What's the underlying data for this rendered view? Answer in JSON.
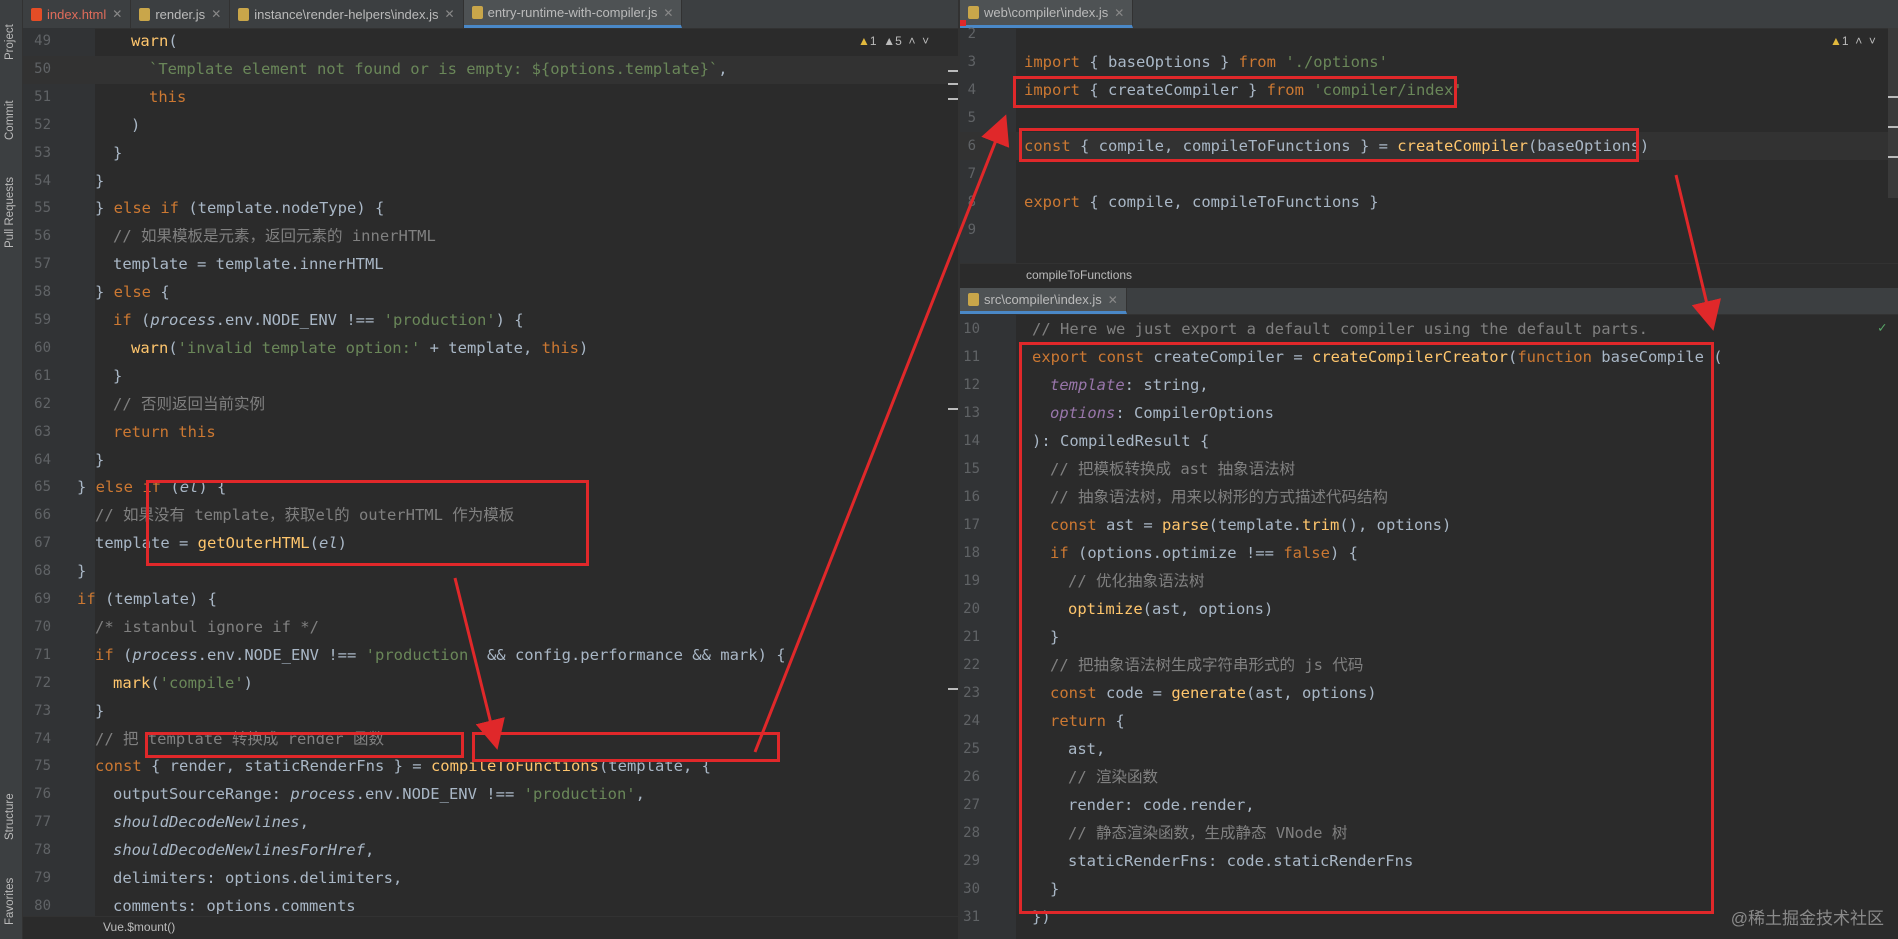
{
  "toolstrip": [
    "Project",
    "Commit",
    "Pull Requests",
    "Structure",
    "Favorites"
  ],
  "left": {
    "tabs": [
      "index.html",
      "render.js",
      "instance\\render-helpers\\index.js",
      "entry-runtime-with-compiler.js"
    ],
    "warnings": {
      "w": "1",
      "w2": "5"
    },
    "breadcrumb": "Vue.$mount()",
    "lines": [
      {
        "n": "49",
        "html": "warn("
      },
      {
        "n": "50",
        "html": "`Template element not found or is empty: ${options.template}`,"
      },
      {
        "n": "51",
        "html": "this"
      },
      {
        "n": "52",
        "html": ")"
      },
      {
        "n": "53",
        "html": "}"
      },
      {
        "n": "54",
        "html": "}"
      },
      {
        "n": "55",
        "html": "} else if (template.nodeType) {"
      },
      {
        "n": "56",
        "html": "// 如果模板是元素，返回元素的 innerHTML"
      },
      {
        "n": "57",
        "html": "template = template.innerHTML"
      },
      {
        "n": "58",
        "html": "} else {"
      },
      {
        "n": "59",
        "html": "if (process.env.NODE_ENV !== 'production') {"
      },
      {
        "n": "60",
        "html": "warn('invalid template option:' + template, this)"
      },
      {
        "n": "61",
        "html": "}"
      },
      {
        "n": "62",
        "html": "// 否则返回当前实例"
      },
      {
        "n": "63",
        "html": "return this"
      },
      {
        "n": "64",
        "html": "}"
      },
      {
        "n": "65",
        "html": "} else if (el) {"
      },
      {
        "n": "66",
        "html": "// 如果没有 template，获取el的 outerHTML 作为模板"
      },
      {
        "n": "67",
        "html": "template = getOuterHTML(el)"
      },
      {
        "n": "68",
        "html": "}"
      },
      {
        "n": "69",
        "html": "if (template) {"
      },
      {
        "n": "70",
        "html": "/* istanbul ignore if */"
      },
      {
        "n": "71",
        "html": "if (process.env.NODE_ENV !== 'production' && config.performance && mark) {"
      },
      {
        "n": "72",
        "html": "mark('compile')"
      },
      {
        "n": "73",
        "html": "}"
      },
      {
        "n": "74",
        "html": "// 把 template 转换成 render 函数"
      },
      {
        "n": "75",
        "html": "const { render, staticRenderFns } = compileToFunctions(template, {"
      },
      {
        "n": "76",
        "html": "outputSourceRange: process.env.NODE_ENV !== 'production',"
      },
      {
        "n": "77",
        "html": "shouldDecodeNewlines,"
      },
      {
        "n": "78",
        "html": "shouldDecodeNewlinesForHref,"
      },
      {
        "n": "79",
        "html": "delimiters: options.delimiters,"
      },
      {
        "n": "80",
        "html": "comments: options.comments"
      }
    ]
  },
  "rightTop": {
    "tab": "web\\compiler\\index.js",
    "warnings": "1",
    "breadcrumb": "compileToFunctions",
    "lines": [
      {
        "n": "2",
        "t": ""
      },
      {
        "n": "3",
        "t": "import { baseOptions } from './options'"
      },
      {
        "n": "4",
        "t": "import { createCompiler } from 'compiler/index'"
      },
      {
        "n": "5",
        "t": ""
      },
      {
        "n": "6",
        "t": "const { compile, compileToFunctions } = createCompiler(baseOptions)"
      },
      {
        "n": "7",
        "t": ""
      },
      {
        "n": "8",
        "t": "export { compile, compileToFunctions }"
      },
      {
        "n": "9",
        "t": ""
      }
    ]
  },
  "rightBottom": {
    "tab": "src\\compiler\\index.js",
    "lines": [
      {
        "n": "10",
        "t": "// Here we just export a default compiler using the default parts."
      },
      {
        "n": "11",
        "t": "export const createCompiler = createCompilerCreator(function baseCompile ("
      },
      {
        "n": "12",
        "t": "template: string,"
      },
      {
        "n": "13",
        "t": "options: CompilerOptions"
      },
      {
        "n": "14",
        "t": "): CompiledResult {"
      },
      {
        "n": "15",
        "t": "// 把模板转换成 ast 抽象语法树"
      },
      {
        "n": "16",
        "t": "// 抽象语法树，用来以树形的方式描述代码结构"
      },
      {
        "n": "17",
        "t": "const ast = parse(template.trim(), options)"
      },
      {
        "n": "18",
        "t": "if (options.optimize !== false) {"
      },
      {
        "n": "19",
        "t": "// 优化抽象语法树"
      },
      {
        "n": "20",
        "t": "optimize(ast, options)"
      },
      {
        "n": "21",
        "t": "}"
      },
      {
        "n": "22",
        "t": "// 把抽象语法树生成字符串形式的 js 代码"
      },
      {
        "n": "23",
        "t": "const code = generate(ast, options)"
      },
      {
        "n": "24",
        "t": "return {"
      },
      {
        "n": "25",
        "t": "ast,"
      },
      {
        "n": "26",
        "t": "// 渲染函数"
      },
      {
        "n": "27",
        "t": "render: code.render,"
      },
      {
        "n": "28",
        "t": "// 静态渲染函数，生成静态 VNode 树"
      },
      {
        "n": "29",
        "t": "staticRenderFns: code.staticRenderFns"
      },
      {
        "n": "30",
        "t": "}"
      },
      {
        "n": "31",
        "t": "})"
      }
    ]
  },
  "watermark": "@稀土掘金技术社区",
  "colors": {
    "annotation": "#e0282a",
    "background": "#2b2b2b",
    "gutter": "#313335",
    "tabbar": "#3c3f41"
  }
}
